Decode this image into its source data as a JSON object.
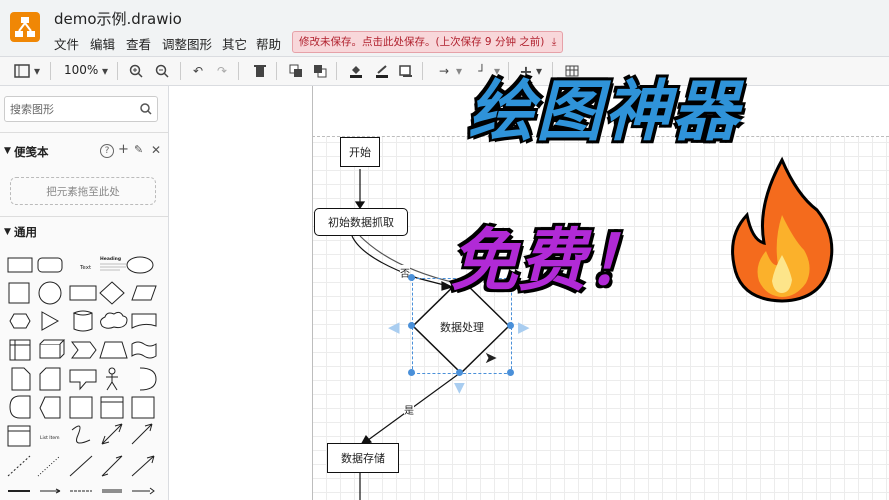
{
  "app": {
    "title": "demo示例.drawio",
    "menu": [
      "文件",
      "编辑",
      "查看",
      "调整图形",
      "其它",
      "帮助"
    ],
    "save_banner": "修改未保存。点击此处保存。(上次保存 9 分钟 之前)"
  },
  "toolbar": {
    "zoom": "100%"
  },
  "sidebar": {
    "search_placeholder": "搜索图形",
    "scratchpad_title": "便笺本",
    "scratchpad_drop": "把元素拖至此处",
    "general_title": "通用",
    "shape_text": "Text",
    "shape_heading": "Heading",
    "shape_list": "List Item"
  },
  "diagram": {
    "start": "开始",
    "fetch": "初始数据抓取",
    "process": "数据处理",
    "store": "数据存储",
    "label_no": "否",
    "label_yes": "是"
  },
  "overlay": {
    "headline1": "绘图神器",
    "headline2": "免费！",
    "fire_icon": "fire-emoji"
  },
  "colors": {
    "brand": "#f08705",
    "selection": "#4a90d9",
    "headline1": "#2f93d9",
    "headline2": "#b12ad6"
  }
}
